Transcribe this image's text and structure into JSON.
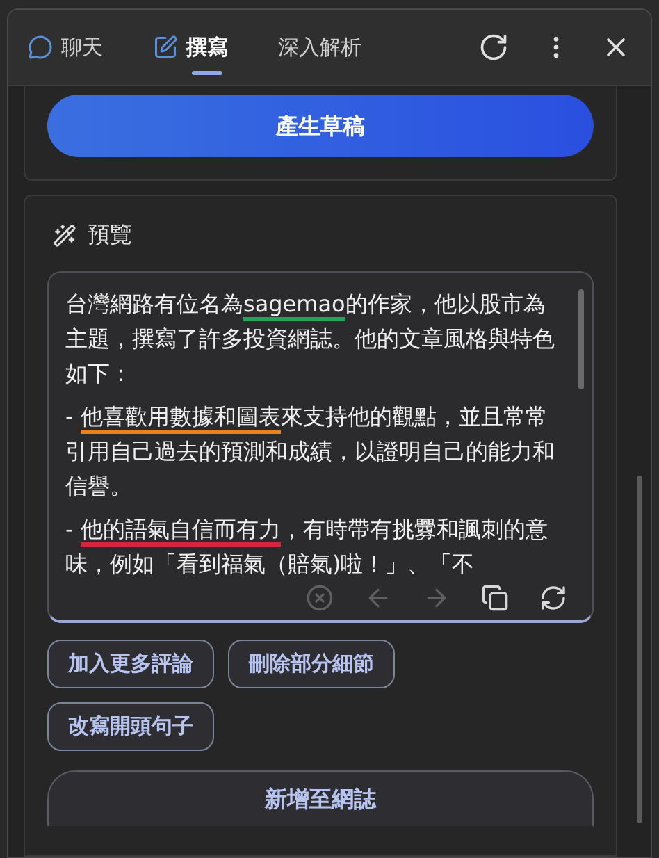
{
  "tabs": [
    {
      "label": "聊天",
      "kind": "chat",
      "selected": false
    },
    {
      "label": "撰寫",
      "kind": "compose",
      "selected": true
    },
    {
      "label": "深入解析",
      "selected": false
    }
  ],
  "generate_button": "產生草稿",
  "preview": {
    "title": "預覽",
    "paragraphs": [
      [
        {
          "text": "台灣網路有位名為"
        },
        {
          "text": "sagemao",
          "color": "#22a559"
        },
        {
          "text": "的作家，他以股市為主題，撰寫了許多投資網誌。他的文章風格與特色如下："
        }
      ],
      [
        {
          "text": "- "
        },
        {
          "text": "他喜歡用數據和圖表",
          "color": "#e8821e"
        },
        {
          "text": "來支持他的觀點，並且常常引用自己過去的預測和成績，以證明自己的能力和信譽。"
        }
      ],
      [
        {
          "text": "- "
        },
        {
          "text": "他的語氣自信而有力",
          "color": "#d6263a"
        },
        {
          "text": "，有時帶有挑釁和諷刺的意味，例如「看到福氣（賠氣)啦！」、「不"
        }
      ]
    ],
    "toolbar": [
      {
        "disabled": true
      },
      {
        "disabled": true
      },
      {
        "disabled": true
      },
      {
        "disabled": false
      },
      {
        "disabled": false
      }
    ]
  },
  "suggestions": [
    "加入更多評論",
    "刪除部分細節",
    "改寫開頭句子"
  ],
  "add_button": "新增至網誌"
}
